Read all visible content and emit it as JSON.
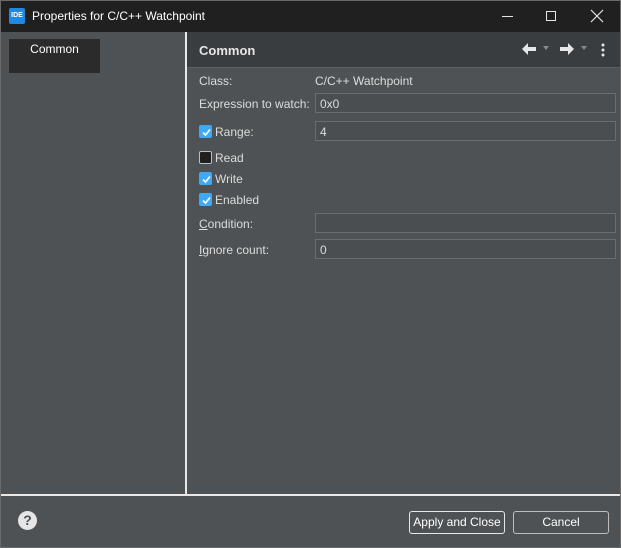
{
  "window": {
    "title": "Properties for C/C++ Watchpoint",
    "app_icon_text": "IDE",
    "close_glyph": "✕"
  },
  "sidebar": {
    "items": [
      {
        "label": "Common",
        "selected": true
      }
    ]
  },
  "content": {
    "title": "Common",
    "class_label": "Class:",
    "class_value": "C/C++ Watchpoint",
    "expression_label": "Expression to watch:",
    "expression_value": "0x0",
    "range_label": "Range:",
    "range_checked": true,
    "range_value": "4",
    "read_label": "Read",
    "read_checked": false,
    "write_label": "Write",
    "write_checked": true,
    "enabled_label": "Enabled",
    "enabled_checked": true,
    "condition_label_rest": "ondition:",
    "condition_label_mnemonic": "C",
    "condition_value": "",
    "ignore_label_mnemonic": "I",
    "ignore_label_rest": "gnore count:",
    "ignore_value": "0"
  },
  "footer": {
    "help_glyph": "?",
    "apply_label": "Apply and Close",
    "cancel_label": "Cancel"
  },
  "colors": {
    "accent": "#3fa9f5",
    "background": "#4e5254",
    "titlebar": "#202020"
  }
}
